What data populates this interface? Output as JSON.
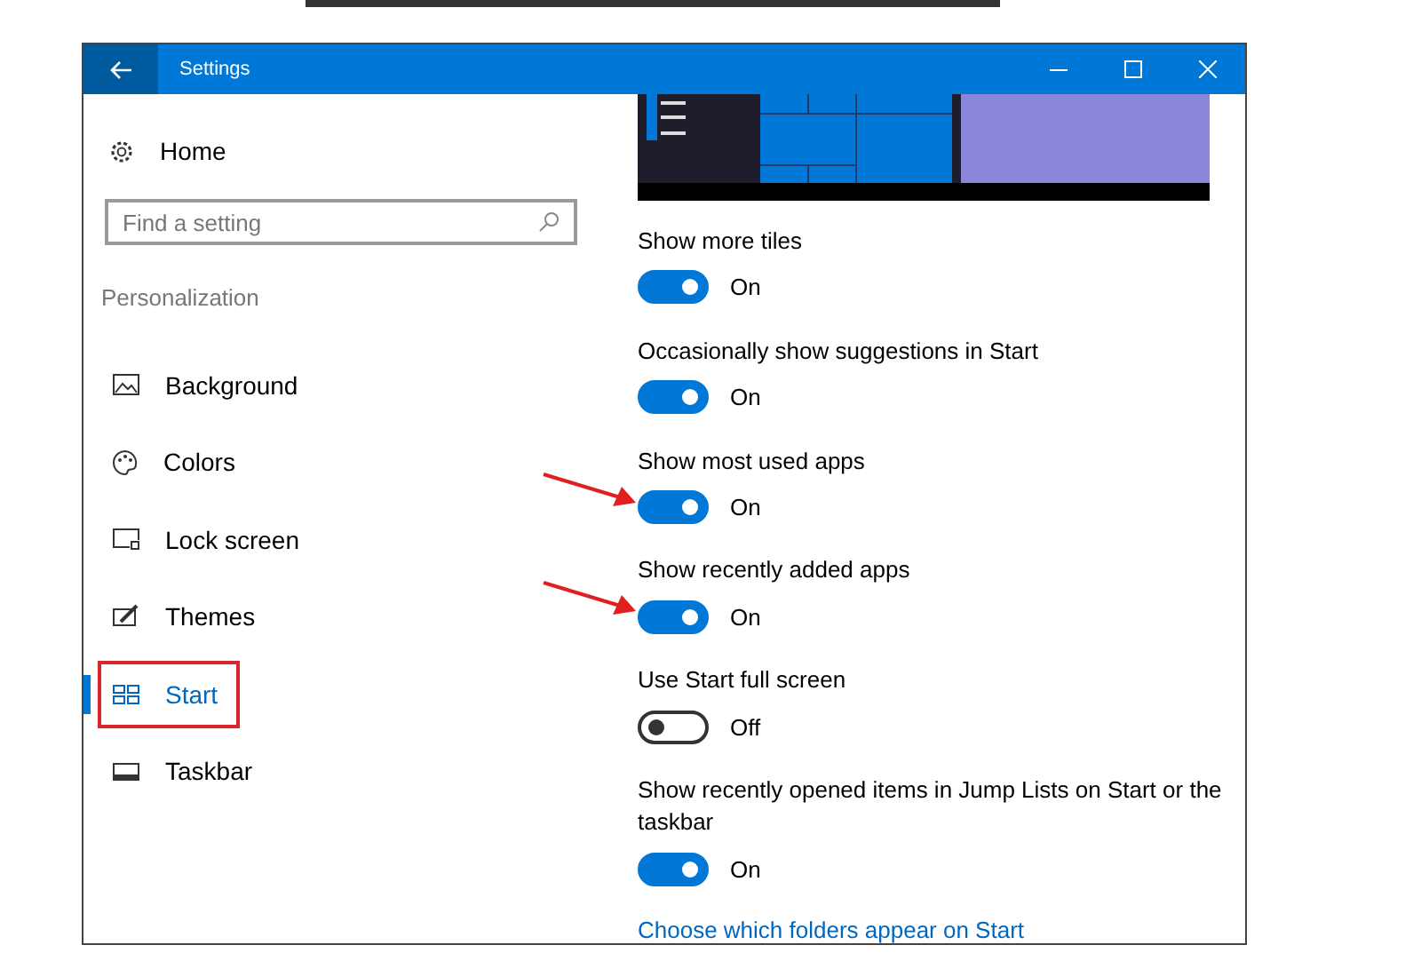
{
  "window": {
    "title": "Settings"
  },
  "sidebar": {
    "home": "Home",
    "search": {
      "placeholder": "Find a setting"
    },
    "section": "Personalization",
    "items": [
      {
        "label": "Background",
        "selected": false,
        "outlined": false
      },
      {
        "label": "Colors",
        "selected": false,
        "outlined": false
      },
      {
        "label": "Lock screen",
        "selected": false,
        "outlined": false
      },
      {
        "label": "Themes",
        "selected": false,
        "outlined": false
      },
      {
        "label": "Start",
        "selected": true,
        "outlined": true
      },
      {
        "label": "Taskbar",
        "selected": false,
        "outlined": false
      }
    ]
  },
  "settings": [
    {
      "label": "Show more tiles",
      "on": true,
      "state": "On",
      "arrow": false
    },
    {
      "label": "Occasionally show suggestions in Start",
      "on": true,
      "state": "On",
      "arrow": false
    },
    {
      "label": "Show most used apps",
      "on": true,
      "state": "On",
      "arrow": true
    },
    {
      "label": "Show recently added apps",
      "on": true,
      "state": "On",
      "arrow": true
    },
    {
      "label": "Use Start full screen",
      "on": false,
      "state": "Off",
      "arrow": false
    },
    {
      "label": "Show recently opened items in Jump Lists on Start or the taskbar",
      "on": true,
      "state": "On",
      "arrow": false
    }
  ],
  "link": "Choose which folders appear on Start"
}
